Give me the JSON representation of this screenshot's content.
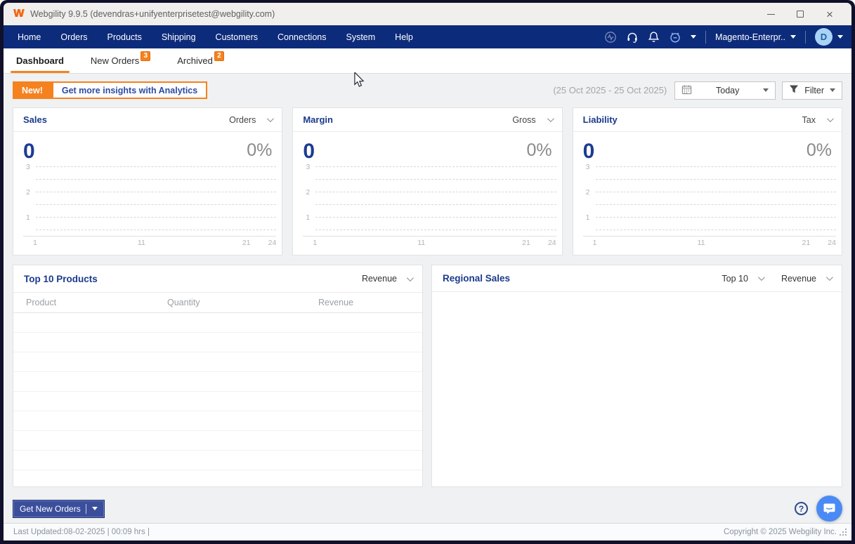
{
  "window": {
    "title": "Webgility 9.9.5 (devendras+unifyenterprisetest@webgility.com)"
  },
  "navbar": {
    "items": [
      "Home",
      "Orders",
      "Products",
      "Shipping",
      "Customers",
      "Connections",
      "System",
      "Help"
    ],
    "icons": [
      "activity-icon",
      "headset-icon",
      "bell-icon",
      "alarm-icon"
    ],
    "store_selector": "Magento-Enterpr..",
    "avatar_initial": "D"
  },
  "tabs": [
    {
      "label": "Dashboard",
      "active": true,
      "badge": ""
    },
    {
      "label": "New Orders",
      "active": false,
      "badge": "3"
    },
    {
      "label": "Archived",
      "active": false,
      "badge": "2"
    }
  ],
  "toolbar": {
    "new_badge": "New!",
    "analytics_label": "Get more insights with Analytics",
    "date_range": "(25 Oct 2025 - 25 Oct 2025)",
    "period_label": "Today",
    "filter_label": "Filter"
  },
  "metric_cards": [
    {
      "title": "Sales",
      "dropdown": "Orders",
      "value": "0",
      "percent": "0%"
    },
    {
      "title": "Margin",
      "dropdown": "Gross",
      "value": "0",
      "percent": "0%"
    },
    {
      "title": "Liability",
      "dropdown": "Tax",
      "value": "0",
      "percent": "0%"
    }
  ],
  "chart_axes": {
    "y_ticks": [
      "3",
      "2",
      "1"
    ],
    "x_ticks": [
      "1",
      "11",
      "21",
      "24"
    ]
  },
  "chart_data": [
    {
      "type": "line",
      "title": "Sales",
      "selected_metric": "Orders",
      "headline_value": 0,
      "headline_percent": "0%",
      "x_ticks": [
        1,
        11,
        21,
        24
      ],
      "y_ticks": [
        1,
        2,
        3
      ],
      "xlim": [
        1,
        24
      ],
      "ylim": [
        0,
        3
      ],
      "grid": "horizontal-dashed",
      "legend": "none",
      "series": []
    },
    {
      "type": "line",
      "title": "Margin",
      "selected_metric": "Gross",
      "headline_value": 0,
      "headline_percent": "0%",
      "x_ticks": [
        1,
        11,
        21,
        24
      ],
      "y_ticks": [
        1,
        2,
        3
      ],
      "xlim": [
        1,
        24
      ],
      "ylim": [
        0,
        3
      ],
      "grid": "horizontal-dashed",
      "legend": "none",
      "series": []
    },
    {
      "type": "line",
      "title": "Liability",
      "selected_metric": "Tax",
      "headline_value": 0,
      "headline_percent": "0%",
      "x_ticks": [
        1,
        11,
        21,
        24
      ],
      "y_ticks": [
        1,
        2,
        3
      ],
      "xlim": [
        1,
        24
      ],
      "ylim": [
        0,
        3
      ],
      "grid": "horizontal-dashed",
      "legend": "none",
      "series": []
    }
  ],
  "top_products": {
    "title": "Top 10 Products",
    "dropdown": "Revenue",
    "columns": [
      "Product",
      "Quantity",
      "Revenue"
    ],
    "rows": []
  },
  "regional": {
    "title": "Regional Sales",
    "range_dropdown": "Top 10",
    "metric_dropdown": "Revenue"
  },
  "actions": {
    "get_new_orders": "Get New Orders"
  },
  "statusbar": {
    "left": "Last Updated:08-02-2025 | 00:09 hrs |",
    "right": "Copyright © 2025 Webgility Inc."
  },
  "colors": {
    "accent_orange": "#F5821F",
    "navy": "#0D2B7B",
    "title_blue": "#1B3A8C",
    "button_blue": "#3B4E9B",
    "chat_blue": "#4A8AF4",
    "avatar_blue": "#A9D3F4"
  }
}
